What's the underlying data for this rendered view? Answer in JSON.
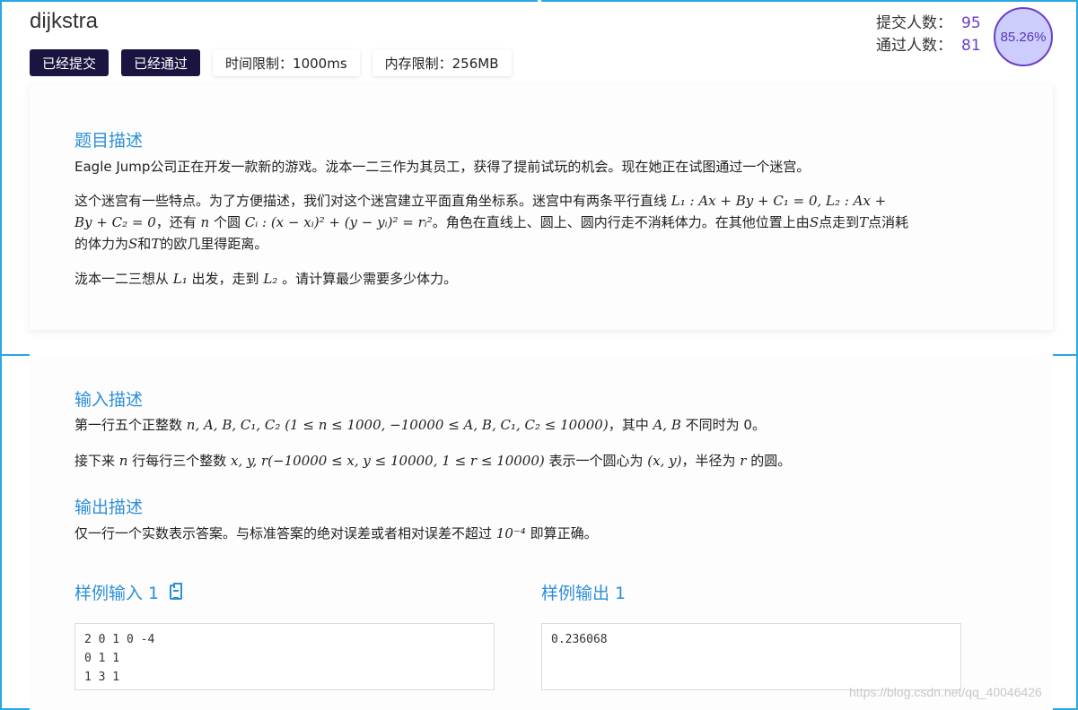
{
  "problem": {
    "title": "dijkstra",
    "tags": [
      "已经提交",
      "已经通过"
    ],
    "time_limit": "时间限制：1000ms",
    "memory_limit": "内存限制：256MB"
  },
  "stats": {
    "submit_label": "提交人数：",
    "submit_count": "95",
    "pass_label": "通过人数：",
    "pass_count": "81",
    "pass_rate": "85.26%"
  },
  "description": {
    "heading": "题目描述",
    "p1": "Eagle Jump公司正在开发一款新的游戏。泷本一二三作为其员工，获得了提前试玩的机会。现在她正在试图通过一个迷宫。",
    "p2_a": "这个迷宫有一些特点。为了方便描述，我们对这个迷宫建立平面直角坐标系。迷宫中有两条平行直线 ",
    "p2_m1": "L₁ : Ax + By + C₁ = 0, L₂ : Ax +",
    "p2_m2": "By + C₂ = 0",
    "p2_b": "，还有 ",
    "p2_m3": "n",
    "p2_c": " 个圆 ",
    "p2_m4": "Cᵢ : (x − xᵢ)² + (y − yᵢ)² = rᵢ²",
    "p2_d": "。角色在直线上、圆上、圆内行走不消耗体力。在其他位置上由",
    "p2_m5": "S",
    "p2_e": "点走到",
    "p2_m6": "T",
    "p2_f": "点消耗",
    "p2_g": "的体力为",
    "p2_m7": "S",
    "p2_h": "和",
    "p2_m8": "T",
    "p2_i": "的欧几里得距离。",
    "p3_a": "泷本一二三想从 ",
    "p3_m1": "L₁",
    "p3_b": " 出发，走到 ",
    "p3_m2": "L₂",
    "p3_c": " 。请计算最少需要多少体力。"
  },
  "input": {
    "heading": "输入描述",
    "l1_a": "第一行五个正整数 ",
    "l1_m1": "n, A, B, C₁, C₂ (1 ≤ n ≤ 1000, −10000 ≤ A, B, C₁, C₂ ≤ 10000)",
    "l1_b": "，其中 ",
    "l1_m2": "A, B",
    "l1_c": " 不同时为 0。",
    "l2_a": "接下来 ",
    "l2_m1": "n",
    "l2_b": " 行每行三个整数 ",
    "l2_m2": "x, y, r(−10000 ≤ x, y ≤ 10000, 1 ≤ r ≤ 10000)",
    "l2_c": " 表示一个圆心为 ",
    "l2_m3": "(x, y)",
    "l2_d": "，半径为 ",
    "l2_m4": "r",
    "l2_e": " 的圆。"
  },
  "output": {
    "heading": "输出描述",
    "l1_a": "仅一行一个实数表示答案。与标准答案的绝对误差或者相对误差不超过 ",
    "l1_m": "10⁻⁴",
    "l1_b": " 即算正确。"
  },
  "sample": {
    "input_heading": "样例输入 1",
    "output_heading": "样例输出 1",
    "input_text": "2 0 1 0 -4\n0 1 1\n1 3 1",
    "output_text": "0.236068"
  },
  "watermark": "https://blog.csdn.net/qq_40046426"
}
